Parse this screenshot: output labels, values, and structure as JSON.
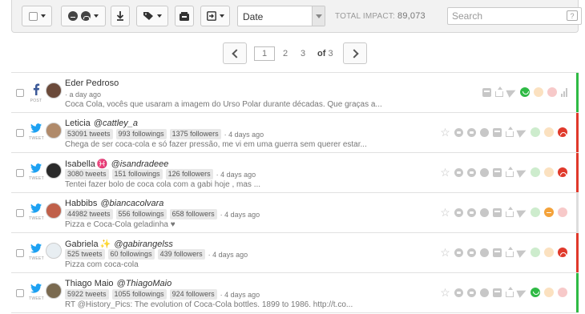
{
  "toolbar": {
    "sort_value": "Date",
    "total_impact_label": "TOTAL IMPACT:",
    "total_impact_value": "89,073",
    "search_placeholder": "Search"
  },
  "pagination": {
    "current": "1",
    "pages": [
      "2",
      "3"
    ],
    "of_label": "of",
    "total": "3"
  },
  "colors": {
    "positive": "#2fba45",
    "negative": "#e0392b",
    "neutral": "#f4a23a",
    "unclassified": "#dddddd",
    "twitter": "#1da1f2",
    "facebook": "#3b5998"
  },
  "mentions": [
    {
      "network": "facebook",
      "network_label": "POST",
      "name": "Eder Pedroso",
      "handle": "",
      "time": "· a day ago",
      "text": "Coca Cola, vocês que usaram a imagem do Urso Polar durante décadas. Que graças a...",
      "sentiment": "positive",
      "avatar_color": "#6b4a3a"
    },
    {
      "network": "twitter",
      "network_label": "TWEET",
      "name": "Leticia",
      "handle": "@cattley_a",
      "tweets": "53091 tweets",
      "followings": "993 followings",
      "followers": "1375 followers",
      "time": "· 4 days ago",
      "text": "Chega de ser coca-cola e só fazer pressão, me vi em uma guerra sem querer estar...",
      "sentiment": "negative",
      "avatar_color": "#b08a6a"
    },
    {
      "network": "twitter",
      "network_label": "TWEET",
      "name": "Isabella",
      "name_symbol": "♓",
      "handle": "@isandradeee",
      "tweets": "3080 tweets",
      "followings": "151 followings",
      "followers": "126 followers",
      "time": "· 4 days ago",
      "text": "Tentei fazer bolo de coca cola com a gabi hoje , mas ...",
      "sentiment": "negative",
      "avatar_color": "#2a2a2a"
    },
    {
      "network": "twitter",
      "network_label": "TWEET",
      "name": "Habbibs",
      "handle": "@biancacolvara",
      "tweets": "44982 tweets",
      "followings": "556 followings",
      "followers": "658 followers",
      "time": "· 4 days ago",
      "text": "Pizza e Coca-Cola geladinha ♥",
      "sentiment": "neutral",
      "avatar_color": "#c0604a"
    },
    {
      "network": "twitter",
      "network_label": "TWEET",
      "name": "Gabriela",
      "name_symbol": "✨",
      "handle": "@gabirangelss",
      "tweets": "525 tweets",
      "followings": "60 followings",
      "followers": "439 followers",
      "time": "· 4 days ago",
      "text": "Pizza com coca-cola",
      "sentiment": "negative",
      "avatar_color": "#e8eef2"
    },
    {
      "network": "twitter",
      "network_label": "TWEET",
      "name": "Thiago Maio",
      "handle": "@ThiagoMaio",
      "tweets": "5922 tweets",
      "followings": "1055 followings",
      "followers": "924 followers",
      "time": "· 4 days ago",
      "text": "RT @History_Pics: The evolution of Coca-Cola bottles. 1899 to 1986. http://t.co...",
      "sentiment": "positive",
      "avatar_color": "#7a6a50"
    }
  ]
}
